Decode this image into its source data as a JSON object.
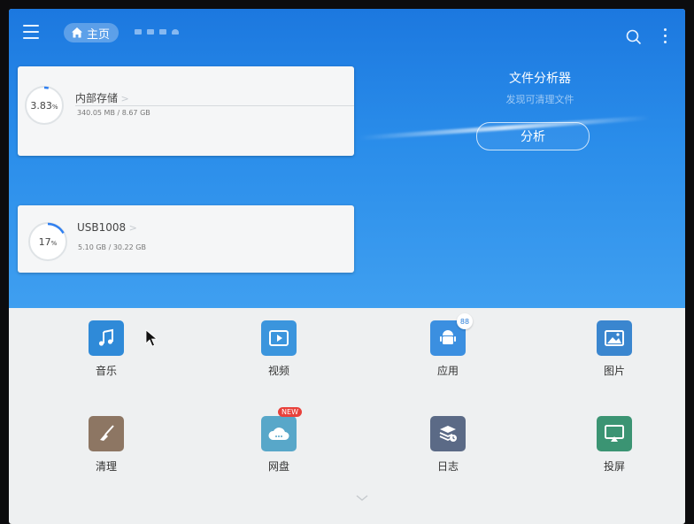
{
  "topbar": {
    "home_label": "主页"
  },
  "storage": {
    "internal": {
      "percent": "3.83",
      "unit": "%",
      "title": "内部存储",
      "usage": "340.05 MB / 8.67 GB",
      "fraction": 0.0383
    },
    "usb": {
      "percent": "17",
      "unit": "%",
      "title": "USB1008",
      "usage": "5.10 GB / 30.22 GB",
      "fraction": 0.17
    }
  },
  "analyzer": {
    "title": "文件分析器",
    "subtitle": "发现可清理文件",
    "button_label": "分析"
  },
  "categories": [
    {
      "label": "音乐",
      "icon": "music-note-icon",
      "color": "#2f8ad8"
    },
    {
      "label": "视频",
      "icon": "video-play-icon",
      "color": "#3b95dd"
    },
    {
      "label": "应用",
      "icon": "android-icon",
      "color": "#3b8fe0",
      "badge": "88"
    },
    {
      "label": "图片",
      "icon": "image-icon",
      "color": "#3a86cf"
    },
    {
      "label": "清理",
      "icon": "broom-icon",
      "color": "#8d7663"
    },
    {
      "label": "网盘",
      "icon": "cloud-icon",
      "color": "#58a7c9",
      "badge": "NEW"
    },
    {
      "label": "日志",
      "icon": "layers-clock-icon",
      "color": "#5b6a86"
    },
    {
      "label": "投屏",
      "icon": "screen-cast-icon",
      "color": "#3b9473"
    }
  ],
  "colors": {
    "accent": "#2a8dea",
    "ring_progress": "#2f7ff0",
    "new_badge": "#e8413b"
  }
}
